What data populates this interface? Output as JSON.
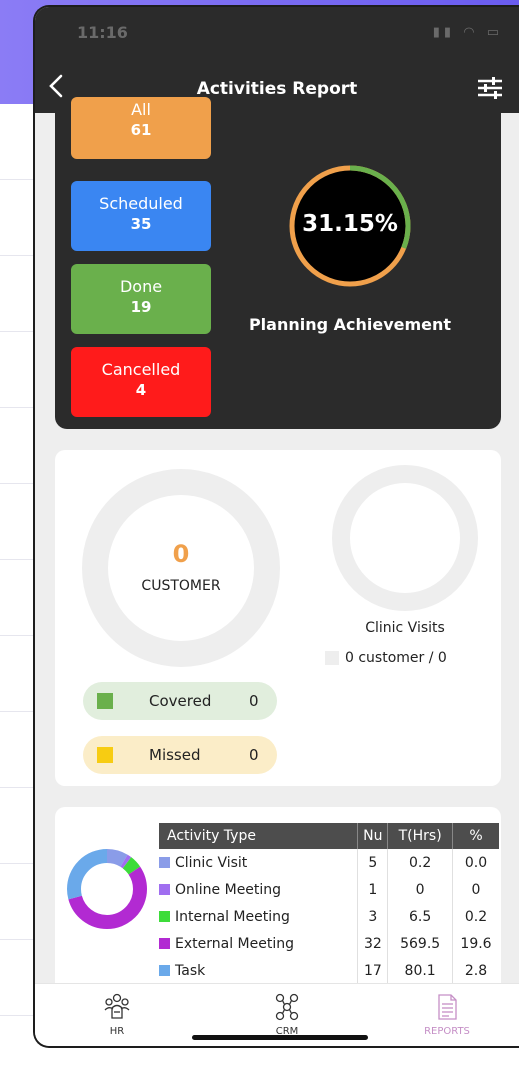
{
  "status_bar": {
    "time": "11:16",
    "icons": [
      "signal-icon",
      "wifi-icon",
      "battery-icon"
    ]
  },
  "nav": {
    "title": "Activities Report",
    "back_icon": "chevron-left-icon",
    "filter_icon": "sliders-icon"
  },
  "summary": {
    "stats": [
      {
        "label": "All",
        "count": "61",
        "color": "#f0a04b"
      },
      {
        "label": "Scheduled",
        "count": "35",
        "color": "#3a86f2"
      },
      {
        "label": "Done",
        "count": "19",
        "color": "#6ab04c"
      },
      {
        "label": "Cancelled",
        "count": "4",
        "color": "#ff1b1b"
      }
    ],
    "achievement_value": "31.15%",
    "achievement_fraction": 0.3115,
    "achievement_label": "Planning Achievement"
  },
  "customers": {
    "count": "0",
    "label": "CUSTOMER",
    "clinic_label": "Clinic Visits",
    "clinic_legend": "0 customer / 0",
    "covered": {
      "label": "Covered",
      "value": "0",
      "color": "#6ab04c"
    },
    "missed": {
      "label": "Missed",
      "value": "0",
      "color": "#f7cc12"
    }
  },
  "activity_table": {
    "headers": [
      "Activity Type",
      "Nu",
      "T(Hrs)",
      "%"
    ],
    "rows": [
      {
        "type": "Clinic Visit",
        "nu": "5",
        "hrs": "0.2",
        "pct": "0.0",
        "color": "#8a9ce8"
      },
      {
        "type": "Online Meeting",
        "nu": "1",
        "hrs": "0",
        "pct": "0",
        "color": "#a06ef0"
      },
      {
        "type": "Internal Meeting",
        "nu": "3",
        "hrs": "6.5",
        "pct": "0.2",
        "color": "#3ddc3a"
      },
      {
        "type": "External Meeting",
        "nu": "32",
        "hrs": "569.5",
        "pct": "19.6",
        "color": "#b22ad2"
      },
      {
        "type": "Task",
        "nu": "17",
        "hrs": "80.1",
        "pct": "2.8",
        "color": "#6aa9ea"
      }
    ]
  },
  "tabs": [
    {
      "label": "HR",
      "icon": "hr-team-icon"
    },
    {
      "label": "CRM",
      "icon": "crm-network-icon"
    },
    {
      "label": "REPORTS",
      "icon": "reports-document-icon"
    }
  ]
}
